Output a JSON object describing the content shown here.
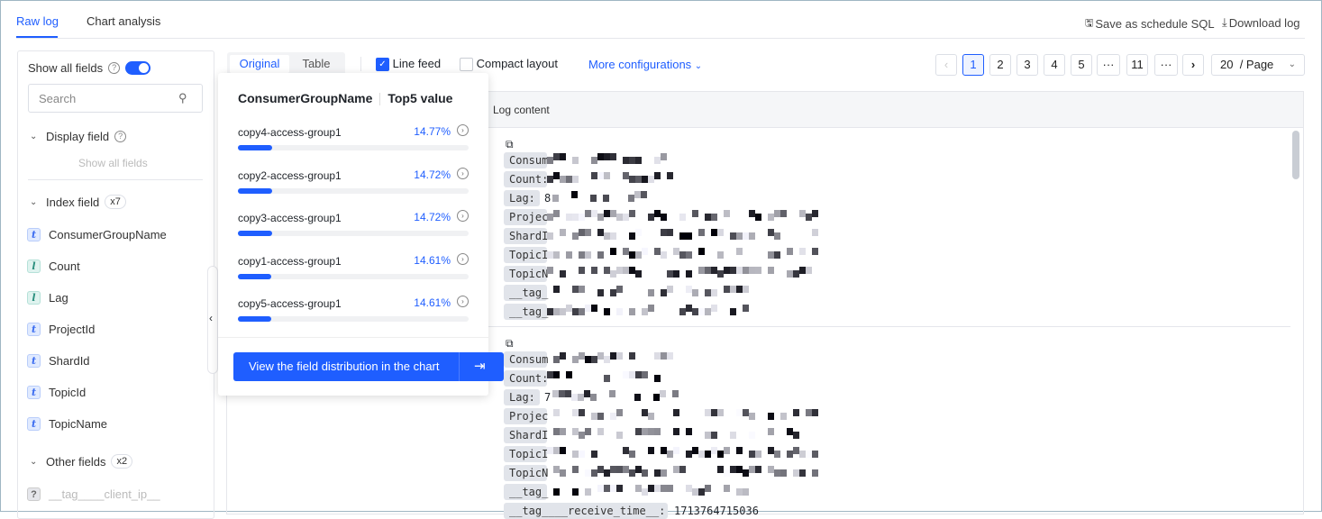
{
  "tabs": [
    {
      "label": "Raw log",
      "active": true
    },
    {
      "label": "Chart analysis",
      "active": false
    }
  ],
  "actions": {
    "save_sql": "Save as schedule SQL",
    "download": "Download log"
  },
  "sidebar": {
    "show_all_fields": "Show all fields",
    "show_all_on": true,
    "search_placeholder": "Search",
    "display_field": "Display field",
    "display_empty": "Show all fields",
    "index_field": "Index field",
    "index_count": "x7",
    "index_items": [
      {
        "type": "t",
        "name": "ConsumerGroupName"
      },
      {
        "type": "l",
        "name": "Count"
      },
      {
        "type": "l",
        "name": "Lag"
      },
      {
        "type": "t",
        "name": "ProjectId"
      },
      {
        "type": "t",
        "name": "ShardId"
      },
      {
        "type": "t",
        "name": "TopicId"
      },
      {
        "type": "t",
        "name": "TopicName"
      }
    ],
    "other_field": "Other fields",
    "other_count": "x2",
    "other_items": [
      {
        "type": "?",
        "name": "__tag____client_ip__"
      }
    ]
  },
  "toolbar": {
    "seg": [
      "Original",
      "Table"
    ],
    "line_feed": "Line feed",
    "line_feed_checked": true,
    "compact": "Compact layout",
    "compact_checked": false,
    "more": "More configurations"
  },
  "pagination": {
    "pages": [
      "1",
      "2",
      "3",
      "4",
      "5",
      "···",
      "11",
      "···"
    ],
    "current": "1",
    "page_size": "20",
    "page_size_suffix": "/ Page"
  },
  "log": {
    "header": "Log content",
    "entries": [
      {
        "labels": [
          "Consum",
          "Count:",
          "Lag:",
          "Projec",
          "ShardI",
          "TopicI",
          "TopicN",
          "__tag_",
          "__tag_"
        ],
        "lag_digit": "8"
      },
      {
        "labels": [
          "Consum",
          "Count:",
          "Lag:",
          "Projec",
          "ShardI",
          "TopicI",
          "TopicN",
          "__tag_"
        ],
        "lag_digit": "7",
        "last_label": "__tag____receive_time__:",
        "last_value": "1713764715036"
      }
    ]
  },
  "popup": {
    "field": "ConsumerGroupName",
    "title": "Top5 value",
    "items": [
      {
        "name": "copy4-access-group1",
        "pct": "14.77%",
        "value": 14.77
      },
      {
        "name": "copy2-access-group1",
        "pct": "14.72%",
        "value": 14.72
      },
      {
        "name": "copy3-access-group1",
        "pct": "14.72%",
        "value": 14.72
      },
      {
        "name": "copy1-access-group1",
        "pct": "14.61%",
        "value": 14.61
      },
      {
        "name": "copy5-access-group1",
        "pct": "14.61%",
        "value": 14.61
      }
    ],
    "button": "View the field distribution in the chart"
  },
  "colors": {
    "accent": "#1f5eff"
  }
}
